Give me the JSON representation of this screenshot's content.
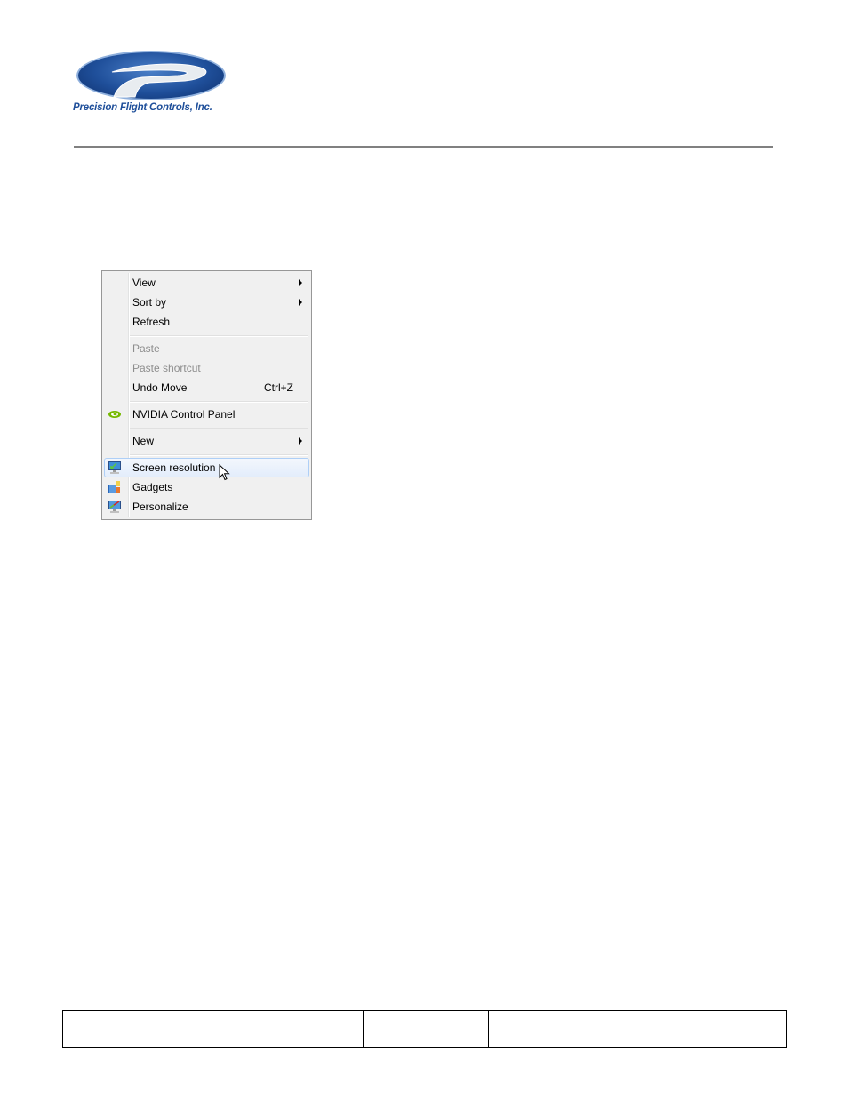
{
  "header": {
    "company_name": "Precision Flight Controls, Inc.",
    "logo_icon": "precision-flight-controls-logo",
    "colors": {
      "logo_blue": "#1f4f9a",
      "rule_gray": "#808080"
    }
  },
  "context_menu": {
    "groups": [
      [
        {
          "label": "View",
          "submenu": true,
          "disabled": false
        },
        {
          "label": "Sort by",
          "submenu": true,
          "disabled": false
        },
        {
          "label": "Refresh",
          "submenu": false,
          "disabled": false
        }
      ],
      [
        {
          "label": "Paste",
          "submenu": false,
          "disabled": true
        },
        {
          "label": "Paste shortcut",
          "submenu": false,
          "disabled": true
        },
        {
          "label": "Undo Move",
          "shortcut": "Ctrl+Z",
          "submenu": false,
          "disabled": false
        }
      ],
      [
        {
          "label": "NVIDIA Control Panel",
          "icon": "nvidia-icon",
          "submenu": false,
          "disabled": false
        }
      ],
      [
        {
          "label": "New",
          "submenu": true,
          "disabled": false
        }
      ],
      [
        {
          "label": "Screen resolution",
          "icon": "screen-resolution-icon",
          "highlighted": true
        },
        {
          "label": "Gadgets",
          "icon": "gadgets-icon"
        },
        {
          "label": "Personalize",
          "icon": "personalize-icon"
        }
      ]
    ],
    "items": {
      "view": "View",
      "sort_by": "Sort by",
      "refresh": "Refresh",
      "paste": "Paste",
      "paste_shortcut": "Paste shortcut",
      "undo_move": "Undo Move",
      "undo_move_shortcut": "Ctrl+Z",
      "nvidia": "NVIDIA Control Panel",
      "new": "New",
      "screen_resolution": "Screen resolution",
      "gadgets": "Gadgets",
      "personalize": "Personalize"
    },
    "highlighted_item": "Screen resolution"
  },
  "footer_table": {
    "cells": [
      "",
      "",
      ""
    ]
  }
}
